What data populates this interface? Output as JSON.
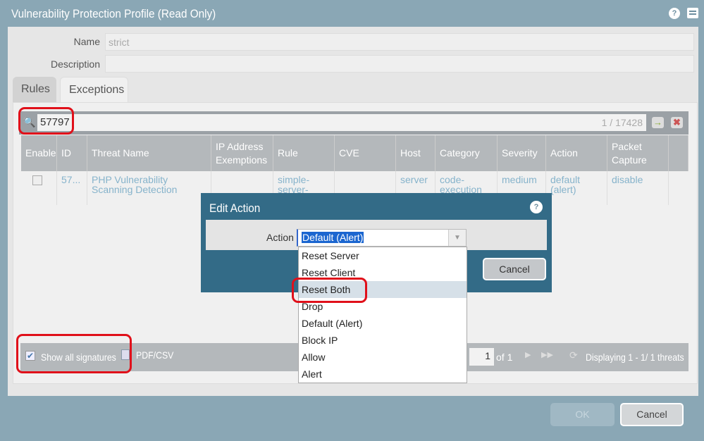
{
  "window": {
    "title": "Vulnerability Protection Profile (Read Only)",
    "help_icon": "help-icon",
    "maximize_icon": "maximize-icon"
  },
  "form": {
    "name_label": "Name",
    "name_value": "strict",
    "description_label": "Description",
    "description_value": ""
  },
  "tabs": [
    {
      "label": "Rules"
    },
    {
      "label": "Exceptions",
      "active": true
    }
  ],
  "search": {
    "value": "57797",
    "count": "1 / 17428"
  },
  "table": {
    "columns": [
      "Enable",
      "ID",
      "Threat Name",
      "IP Address Exemptions",
      "Rule",
      "CVE",
      "Host",
      "Category",
      "Severity",
      "Action",
      "Packet Capture"
    ],
    "rows": [
      {
        "enable": false,
        "id": "57...",
        "threat_name": "PHP Vulnerability Scanning Detection",
        "ip": "",
        "rule": "simple-server-",
        "cve": "",
        "host": "server",
        "category": "code-execution",
        "severity": "medium",
        "action": "default (alert)",
        "packet_capture": "disable"
      }
    ]
  },
  "footer": {
    "show_all_label": "Show all signatures",
    "show_all_checked": true,
    "export_label": "PDF/CSV",
    "page": "1",
    "of": "of 1",
    "displaying": "Displaying 1 - 1/ 1 threats"
  },
  "buttons": {
    "ok": "OK",
    "cancel": "Cancel"
  },
  "dialog": {
    "title": "Edit Action",
    "action_label": "Action",
    "action_value": "Default (Alert)",
    "cancel": "Cancel",
    "options": [
      "Reset Server",
      "Reset Client",
      "Reset Both",
      "Drop",
      "Default (Alert)",
      "Block IP",
      "Allow",
      "Alert"
    ],
    "highlighted": "Reset Both"
  },
  "colors": {
    "frame": "#8aa7b5",
    "dialog": "#336b87",
    "link": "#86b3cb",
    "annotation": "#e0101a"
  }
}
